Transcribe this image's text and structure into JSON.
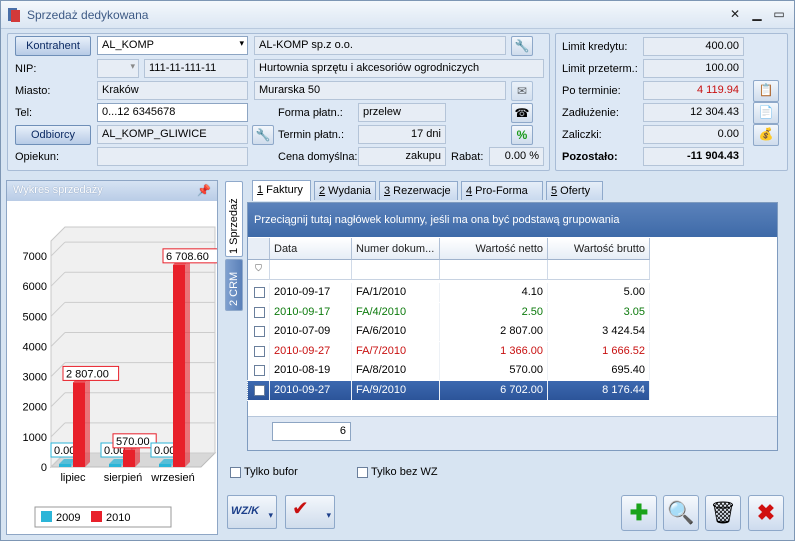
{
  "window": {
    "title": "Sprzedaż dedykowana"
  },
  "header": {
    "kontrahent_btn": "Kontrahent",
    "kontrahent_code": "AL_KOMP",
    "company_name": "AL-KOMP sp.z o.o.",
    "nip_label": "NIP:",
    "nip": "111-11-111-11",
    "description": "Hurtownia sprzętu i akcesoriów ogrodniczych",
    "miasto_label": "Miasto:",
    "miasto": "Kraków",
    "street": "Murarska 50",
    "tel_label": "Tel:",
    "tel": "0...12 6345678",
    "forma_label": "Forma  płatn.:",
    "forma": "przelew",
    "odbiorcy_btn": "Odbiorcy",
    "odbiorca_code": "AL_KOMP_GLIWICE",
    "termin_label": "Termin płatn.:",
    "termin": "17 dni",
    "opiekun_label": "Opiekun:",
    "opiekun": "",
    "cena_label": "Cena domyślna:",
    "cena": "zakupu",
    "rabat_label": "Rabat:",
    "rabat": "0.00 %"
  },
  "limits": {
    "limit_label": "Limit kredytu:",
    "limit": "400.00",
    "przeterm_label": "Limit przeterm.:",
    "przeterm": "100.00",
    "po_terminie_label": "Po terminie:",
    "po_terminie": "4 119.94",
    "zadluzenie_label": "Zadłużenie:",
    "zadluzenie": "12 304.43",
    "zaliczki_label": "Zaliczki:",
    "zaliczki": "0.00",
    "pozostalo_label": "Pozostało:",
    "pozostalo": "-11 904.43"
  },
  "chart_data": {
    "type": "bar",
    "title": "Wykres sprzedaży",
    "categories": [
      "lipiec",
      "sierpień",
      "wrzesień"
    ],
    "series": [
      {
        "name": "2009",
        "color": "#2bb5d8",
        "values": [
          0,
          0,
          0
        ]
      },
      {
        "name": "2010",
        "color": "#e8202a",
        "values": [
          2807,
          570,
          6708.6
        ]
      }
    ],
    "data_labels": {
      "2009": [
        "0.00",
        "0.00",
        "0.00"
      ],
      "2010": [
        "2 807.00",
        "570.00",
        "6 708.60"
      ]
    },
    "y_ticks": [
      "0",
      "1000",
      "2000",
      "3000",
      "4000",
      "5000",
      "6000",
      "7000"
    ],
    "ylim": [
      0,
      7500
    ],
    "legend": "bottom"
  },
  "sidetabs": {
    "sprzedaz": "1 Sprzedaż",
    "crm": "2 CRM"
  },
  "tabs": [
    {
      "num": "1",
      "label": " Faktury"
    },
    {
      "num": "2",
      "label": " Wydania"
    },
    {
      "num": "3",
      "label": " Rezerwacje"
    },
    {
      "num": "4",
      "label": " Pro-Forma"
    },
    {
      "num": "5",
      "label": " Oferty"
    }
  ],
  "grid": {
    "group_hint": "Przeciągnij tutaj nagłówek kolumny, jeśli ma ona być podstawą grupowania",
    "columns": [
      "Data",
      "Numer dokum...",
      "Wartość netto",
      "Wartość brutto"
    ],
    "rows": [
      {
        "data": "2010-09-17",
        "numer": "FA/1/2010",
        "netto": "4.10",
        "brutto": "5.00",
        "color": "#000000"
      },
      {
        "data": "2010-09-17",
        "numer": "FA/4/2010",
        "netto": "2.50",
        "brutto": "3.05",
        "color": "#0c7a0c"
      },
      {
        "data": "2010-07-09",
        "numer": "FA/6/2010",
        "netto": "2 807.00",
        "brutto": "3 424.54",
        "color": "#000000"
      },
      {
        "data": "2010-09-27",
        "numer": "FA/7/2010",
        "netto": "1 366.00",
        "brutto": "1 666.52",
        "color": "#c81010"
      },
      {
        "data": "2010-08-19",
        "numer": "FA/8/2010",
        "netto": "570.00",
        "brutto": "695.40",
        "color": "#000000"
      },
      {
        "data": "2010-09-27",
        "numer": "FA/9/2010",
        "netto": "6 702.00",
        "brutto": "8 176.44",
        "color": "#ffffff",
        "selected": true
      }
    ],
    "count": "6"
  },
  "options": {
    "tylko_bufor": "Tylko bufor",
    "tylko_bez_wz": "Tylko bez WZ"
  },
  "toolbar": {
    "wzk": "WZ/K"
  }
}
